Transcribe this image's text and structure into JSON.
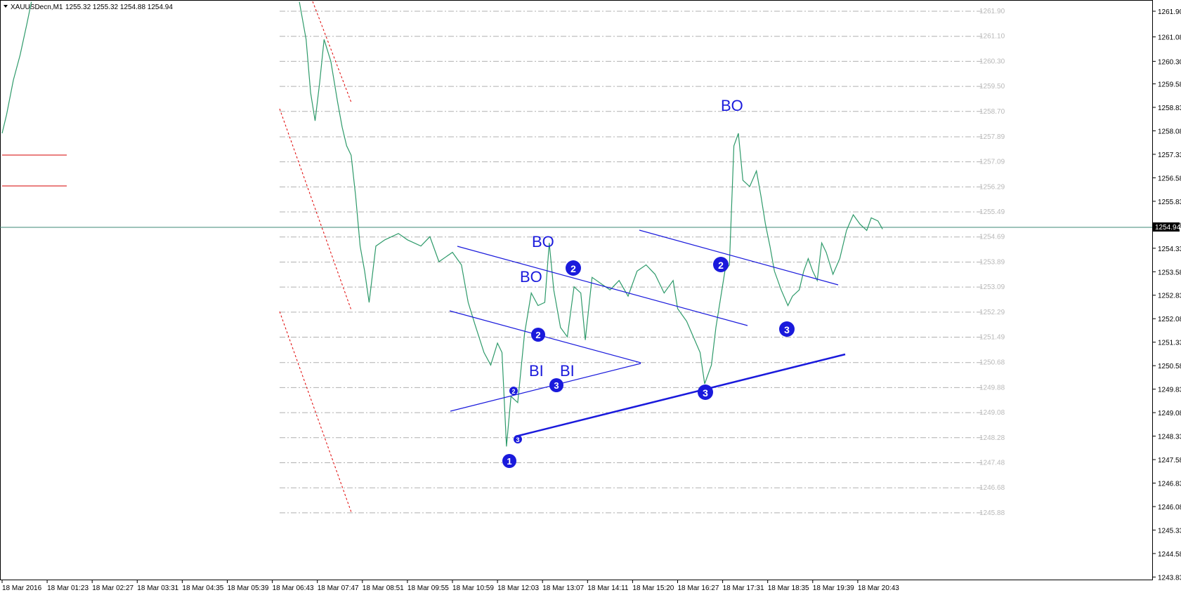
{
  "header": {
    "symbol": "XAUUSDecn,M1",
    "ohlc": "1255.32 1255.32 1254.88 1254.94"
  },
  "current_price_label": "1254.94",
  "y_axis_labels": [
    "1261.90",
    "1261.08",
    "1260.30",
    "1259.58",
    "1258.83",
    "1258.08",
    "1257.33",
    "1256.58",
    "1255.83",
    "1255.08",
    "1254.33",
    "1253.58",
    "1252.83",
    "1252.08",
    "1251.33",
    "1250.58",
    "1249.83",
    "1249.08",
    "1248.33",
    "1247.58",
    "1246.83",
    "1246.08",
    "1245.33",
    "1244.58",
    "1243.83"
  ],
  "level_labels": [
    "1261.90",
    "1261.10",
    "1260.30",
    "1259.50",
    "1258.70",
    "1257.89",
    "1257.09",
    "1256.29",
    "1255.49",
    "1254.69",
    "1253.89",
    "1253.09",
    "1252.29",
    "1251.49",
    "1250.68",
    "1249.88",
    "1249.08",
    "1248.28",
    "1247.48",
    "1246.68",
    "1245.88"
  ],
  "x_axis_labels": [
    "18 Mar 2016",
    "18 Mar 01:23",
    "18 Mar 02:27",
    "18 Mar 03:31",
    "18 Mar 04:35",
    "18 Mar 05:39",
    "18 Mar 06:43",
    "18 Mar 07:47",
    "18 Mar 08:51",
    "18 Mar 09:55",
    "18 Mar 10:59",
    "18 Mar 12:03",
    "18 Mar 13:07",
    "18 Mar 14:11",
    "18 Mar 15:20",
    "18 Mar 16:27",
    "18 Mar 17:31",
    "18 Mar 18:35",
    "18 Mar 19:39",
    "18 Mar 20:43"
  ],
  "annotations": {
    "bo_labels": [
      "BO",
      "BO",
      "BO"
    ],
    "bi_labels": [
      "BI",
      "BI"
    ],
    "wave_markers": [
      "1",
      "2",
      "3",
      "2",
      "3",
      "2",
      "3",
      "2",
      "3",
      "2",
      "3"
    ]
  },
  "colors": {
    "price_line": "#2e9a6a",
    "annotation_blue": "#1a1adc",
    "trendline_blue": "#1a1adc",
    "red_dotted": "#e00000",
    "red_level": "#d40000",
    "grid_dash": "#b0b0b0",
    "current_price_line": "#3c8a74"
  },
  "chart_data": {
    "type": "line",
    "title": "",
    "xlabel": "",
    "ylabel": "",
    "ylim": [
      1243.83,
      1262.2
    ],
    "x": [
      "18 Mar 2016",
      "18 Mar 01:23",
      "18 Mar 02:27",
      "18 Mar 03:31",
      "18 Mar 04:35",
      "18 Mar 05:39",
      "18 Mar 06:43",
      "18 Mar 07:47",
      "18 Mar 08:51",
      "18 Mar 09:55",
      "18 Mar 10:59",
      "18 Mar 12:03",
      "18 Mar 13:07",
      "18 Mar 14:11",
      "18 Mar 15:20",
      "18 Mar 16:27",
      "18 Mar 17:31",
      "18 Mar 18:35",
      "18 Mar 19:39",
      "18 Mar 20:43"
    ],
    "series": [
      {
        "points": [
          [
            0.0,
            1258.0
          ],
          [
            0.1,
            1258.6
          ],
          [
            0.25,
            1259.7
          ],
          [
            0.4,
            1260.5
          ],
          [
            0.55,
            1261.5
          ],
          [
            0.65,
            1262.2
          ],
          [
            6.6,
            1262.2
          ],
          [
            6.75,
            1261.0
          ],
          [
            6.85,
            1259.3
          ],
          [
            6.95,
            1258.4
          ],
          [
            7.05,
            1259.6
          ],
          [
            7.15,
            1261.0
          ],
          [
            7.3,
            1260.3
          ],
          [
            7.45,
            1259.0
          ],
          [
            7.55,
            1258.2
          ],
          [
            7.65,
            1257.6
          ],
          [
            7.75,
            1257.3
          ],
          [
            7.85,
            1256.0
          ],
          [
            7.95,
            1254.4
          ],
          [
            8.05,
            1253.6
          ],
          [
            8.15,
            1252.6
          ],
          [
            8.3,
            1254.4
          ],
          [
            8.5,
            1254.6
          ],
          [
            8.8,
            1254.8
          ],
          [
            9.0,
            1254.6
          ],
          [
            9.3,
            1254.4
          ],
          [
            9.5,
            1254.7
          ],
          [
            9.7,
            1253.9
          ],
          [
            10.0,
            1254.2
          ],
          [
            10.2,
            1253.8
          ],
          [
            10.35,
            1252.6
          ],
          [
            10.5,
            1251.9
          ],
          [
            10.7,
            1251.0
          ],
          [
            10.85,
            1250.6
          ],
          [
            11.0,
            1251.3
          ],
          [
            11.1,
            1251.0
          ],
          [
            11.2,
            1248.0
          ],
          [
            11.3,
            1249.6
          ],
          [
            11.45,
            1249.4
          ],
          [
            11.6,
            1251.6
          ],
          [
            11.75,
            1252.9
          ],
          [
            11.9,
            1252.5
          ],
          [
            12.05,
            1252.6
          ],
          [
            12.15,
            1254.5
          ],
          [
            12.25,
            1253.0
          ],
          [
            12.4,
            1251.8
          ],
          [
            12.55,
            1251.5
          ],
          [
            12.7,
            1253.1
          ],
          [
            12.85,
            1252.9
          ],
          [
            12.95,
            1251.4
          ],
          [
            13.1,
            1253.4
          ],
          [
            13.3,
            1253.2
          ],
          [
            13.5,
            1253.0
          ],
          [
            13.7,
            1253.3
          ],
          [
            13.9,
            1252.8
          ],
          [
            14.1,
            1253.6
          ],
          [
            14.3,
            1253.8
          ],
          [
            14.5,
            1253.5
          ],
          [
            14.7,
            1252.9
          ],
          [
            14.9,
            1253.3
          ],
          [
            15.0,
            1252.4
          ],
          [
            15.2,
            1252.0
          ],
          [
            15.35,
            1251.5
          ],
          [
            15.5,
            1251.0
          ],
          [
            15.6,
            1250.0
          ],
          [
            15.75,
            1250.6
          ],
          [
            15.85,
            1251.8
          ],
          [
            15.95,
            1252.7
          ],
          [
            16.05,
            1253.6
          ],
          [
            16.15,
            1253.8
          ],
          [
            16.25,
            1257.6
          ],
          [
            16.35,
            1258.0
          ],
          [
            16.45,
            1256.5
          ],
          [
            16.6,
            1256.3
          ],
          [
            16.75,
            1256.8
          ],
          [
            16.85,
            1256.0
          ],
          [
            16.95,
            1255.1
          ],
          [
            17.05,
            1254.4
          ],
          [
            17.15,
            1253.6
          ],
          [
            17.3,
            1253.0
          ],
          [
            17.45,
            1252.5
          ],
          [
            17.55,
            1252.8
          ],
          [
            17.7,
            1253.0
          ],
          [
            17.8,
            1253.6
          ],
          [
            17.9,
            1254.0
          ],
          [
            18.0,
            1253.6
          ],
          [
            18.1,
            1253.3
          ],
          [
            18.2,
            1254.5
          ],
          [
            18.3,
            1254.2
          ],
          [
            18.45,
            1253.5
          ],
          [
            18.6,
            1254.0
          ],
          [
            18.75,
            1254.9
          ],
          [
            18.9,
            1255.4
          ],
          [
            19.05,
            1255.1
          ],
          [
            19.2,
            1254.9
          ],
          [
            19.3,
            1255.3
          ],
          [
            19.45,
            1255.2
          ],
          [
            19.55,
            1254.94
          ]
        ]
      }
    ]
  }
}
